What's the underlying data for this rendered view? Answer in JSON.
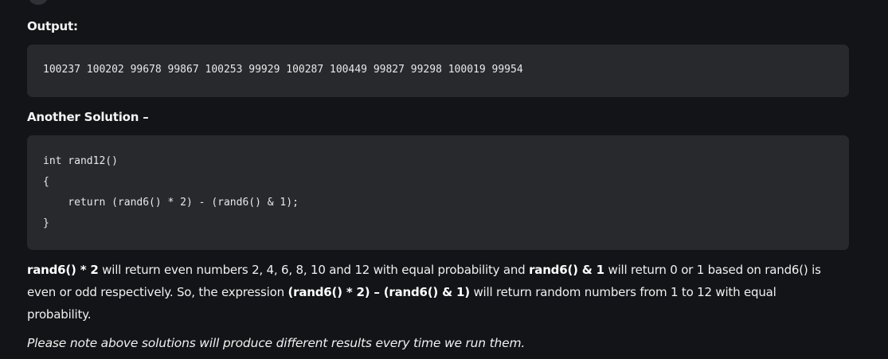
{
  "output_label": "Output:",
  "output_code": "100237 100202 99678 99867 100253 99929 100287 100449 99827 99298 100019 99954",
  "another_solution_label": "Another Solution –",
  "solution_code": [
    "int rand12()",
    "{",
    "    return (rand6() * 2) - (rand6() & 1);",
    "}"
  ],
  "explanation": {
    "b1": "rand6() * 2",
    "t1": " will return even numbers 2, 4, 6, 8, 10 and 12 with equal probability and ",
    "b2": "rand6() & 1",
    "t2": " will return 0 or 1 based on rand6() is",
    "t3": "even or odd respectively. So, the expression ",
    "b3": "(rand6() * 2) – (rand6() & 1)",
    "t4": " will return random numbers from 1 to 12 with equal",
    "t5": "probability."
  },
  "note": "Please note above solutions will produce different results every time we run them."
}
